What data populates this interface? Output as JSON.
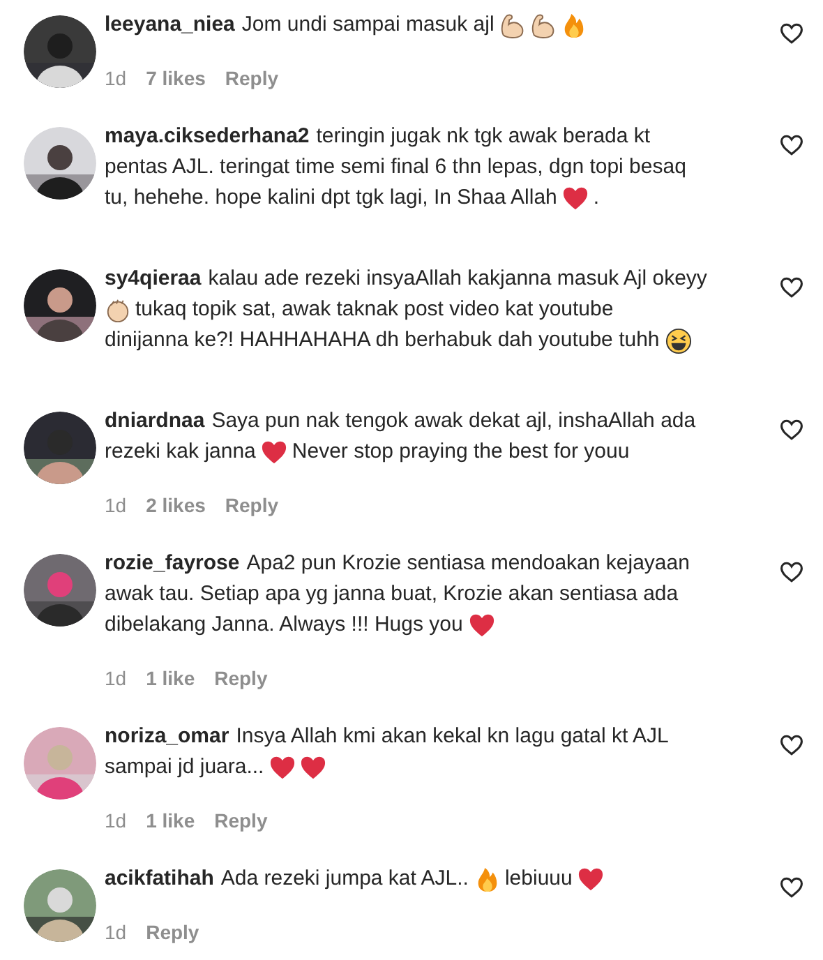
{
  "comments": [
    {
      "username": "leeyana_niea",
      "lines": [
        [
          {
            "kind": "text",
            "text": "Jom undi sampai masuk ajl"
          },
          {
            "kind": "muscle"
          },
          {
            "kind": "muscle"
          },
          {
            "kind": "fire"
          }
        ]
      ],
      "meta": {
        "time": "1d",
        "likes": "7 likes",
        "reply": "Reply"
      }
    },
    {
      "username": "maya.ciksederhana2",
      "lines": [
        [
          {
            "kind": "text",
            "text": "teringin jugak nk tgk awak berada kt"
          }
        ],
        [
          {
            "kind": "text",
            "text": "pentas AJL. teringat time semi final 6 thn lepas, dgn topi besaq"
          }
        ],
        [
          {
            "kind": "text",
            "text": "tu, hehehe. hope kalini dpt tgk lagi, In Shaa Allah"
          },
          {
            "kind": "heart"
          },
          {
            "kind": "text",
            "text": "."
          }
        ]
      ]
    },
    {
      "username": "sy4qieraa",
      "lines": [
        [
          {
            "kind": "text",
            "text": "kalau ade rezeki insyaAllah kakjanna masuk Ajl okeyy"
          }
        ],
        [
          {
            "kind": "clap"
          },
          {
            "kind": "text",
            "text": "tukaq topik sat, awak taknak post video kat youtube"
          }
        ],
        [
          {
            "kind": "text",
            "text": "dinijanna ke?! HAHHAHAHA dh berhabuk dah youtube tuhh"
          },
          {
            "kind": "laugh"
          }
        ]
      ]
    },
    {
      "username": "dniardnaa",
      "lines": [
        [
          {
            "kind": "text",
            "text": "Saya pun nak tengok awak dekat ajl, inshaAllah ada"
          }
        ],
        [
          {
            "kind": "text",
            "text": "rezeki kak janna"
          },
          {
            "kind": "heart"
          },
          {
            "kind": "text",
            "text": "Never stop praying the best for youu"
          }
        ]
      ],
      "meta": {
        "time": "1d",
        "likes": "2 likes",
        "reply": "Reply"
      }
    },
    {
      "username": "rozie_fayrose",
      "lines": [
        [
          {
            "kind": "text",
            "text": "Apa2 pun Krozie sentiasa mendoakan kejayaan"
          }
        ],
        [
          {
            "kind": "text",
            "text": "awak tau. Setiap apa yg janna buat, Krozie akan sentiasa ada"
          }
        ],
        [
          {
            "kind": "text",
            "text": "dibelakang Janna. Always !!! Hugs you"
          },
          {
            "kind": "heart"
          }
        ]
      ],
      "meta": {
        "time": "1d",
        "likes": "1 like",
        "reply": "Reply"
      }
    },
    {
      "username": "noriza_omar",
      "lines": [
        [
          {
            "kind": "text",
            "text": "Insya Allah kmi akan kekal kn lagu gatal kt AJL"
          }
        ],
        [
          {
            "kind": "text",
            "text": "sampai jd juara..."
          },
          {
            "kind": "heart"
          },
          {
            "kind": "heart"
          }
        ]
      ],
      "meta": {
        "time": "1d",
        "likes": "1 like",
        "reply": "Reply"
      }
    },
    {
      "username": "acikfatihah",
      "lines": [
        [
          {
            "kind": "text",
            "text": "Ada rezeki jumpa kat AJL.."
          },
          {
            "kind": "fire"
          },
          {
            "kind": "text",
            "text": "lebiuuu"
          },
          {
            "kind": "heart"
          }
        ]
      ],
      "meta": {
        "time": "1d",
        "reply": "Reply"
      }
    }
  ]
}
